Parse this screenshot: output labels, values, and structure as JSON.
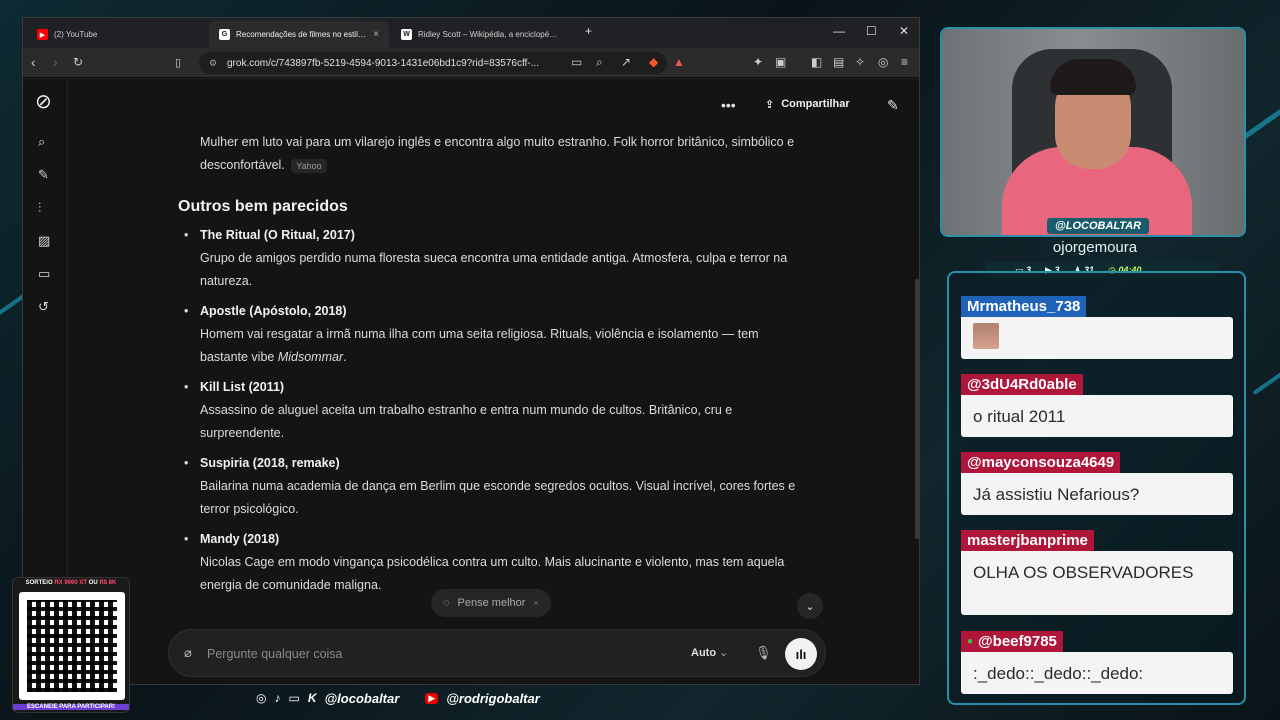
{
  "browser": {
    "tabs": [
      {
        "label": "(2) YouTube",
        "active": false
      },
      {
        "label": "Recomendações de filmes no estilo Mi",
        "active": true
      },
      {
        "label": "Ridley Scott – Wikipédia, a enciclopédia livre",
        "active": false
      }
    ],
    "url": "grok.com/c/743897fb-5219-4594-9013-1431e06bd1c9?rid=83576cff-..."
  },
  "grok": {
    "share_label": "Compartilhar",
    "prev_text": "Mulher em luto vai para um vilarejo inglês e encontra algo muito estranho. Folk horror britânico, simbólico e desconfortável.",
    "prev_source": "Yahoo",
    "section_title": "Outros bem parecidos",
    "items": [
      {
        "title": "The Ritual (O Ritual, 2017)",
        "desc": "Grupo de amigos perdido numa floresta sueca encontra uma entidade antiga. Atmosfera, culpa e terror na natureza."
      },
      {
        "title": "Apostle (Apóstolo, 2018)",
        "desc_before": "Homem vai resgatar a irmã numa ilha com uma seita religiosa. Rituals, violência e isolamento — tem bastante vibe ",
        "desc_em": "Midsommar",
        "desc_after": "."
      },
      {
        "title": "Kill List (2011)",
        "desc": "Assassino de aluguel aceita um trabalho estranho e entra num mundo de cultos. Britânico, cru e surpreendente."
      },
      {
        "title": "Suspiria (2018, remake)",
        "desc": "Bailarina numa academia de dança em Berlim que esconde segredos ocultos. Visual incrível, cores fortes e terror psicológico."
      },
      {
        "title": "Mandy (2018)",
        "desc": "Nicolas Cage em modo vingança psicodélica contra um culto. Mais alucinante e violento, mas tem aquela energia de comunidade maligna."
      }
    ],
    "suggestion": "Pense melhor",
    "composer_placeholder": "Pergunte qualquer coisa",
    "mode": "Auto"
  },
  "stream": {
    "cam_handle": "@LOCOBALTAR",
    "cam_name": "ojorgemoura",
    "stats": [
      "3",
      "3",
      "31"
    ],
    "stat_time": "04:40",
    "chat": [
      {
        "user": "Mrmatheus_738",
        "message": "",
        "color": "#1f63b8"
      },
      {
        "user": "@3dU4Rd0able",
        "message": "o ritual 2011",
        "color": "#b0163a"
      },
      {
        "user": "@mayconsouza4649",
        "message": "Já assistiu Nefarious?",
        "color": "#b0163a"
      },
      {
        "user": "masterjbanprime",
        "message": "OLHA OS OBSERVADORES",
        "color": "#b0163a"
      },
      {
        "user": "@beef9785",
        "message": ":_dedo::_dedo::_dedo:",
        "color": "#b0163a"
      }
    ],
    "socials": [
      "@locobaltar",
      "@rodrigobaltar"
    ],
    "promo_top_prefix": "SORTEIO",
    "promo_top_highlight": "RX 9060 XT",
    "promo_top_mid": "OU",
    "promo_top_highlight2": "R$ 8K",
    "promo_bottom": "ESCANEIE PARA PARTICIPAR!"
  }
}
